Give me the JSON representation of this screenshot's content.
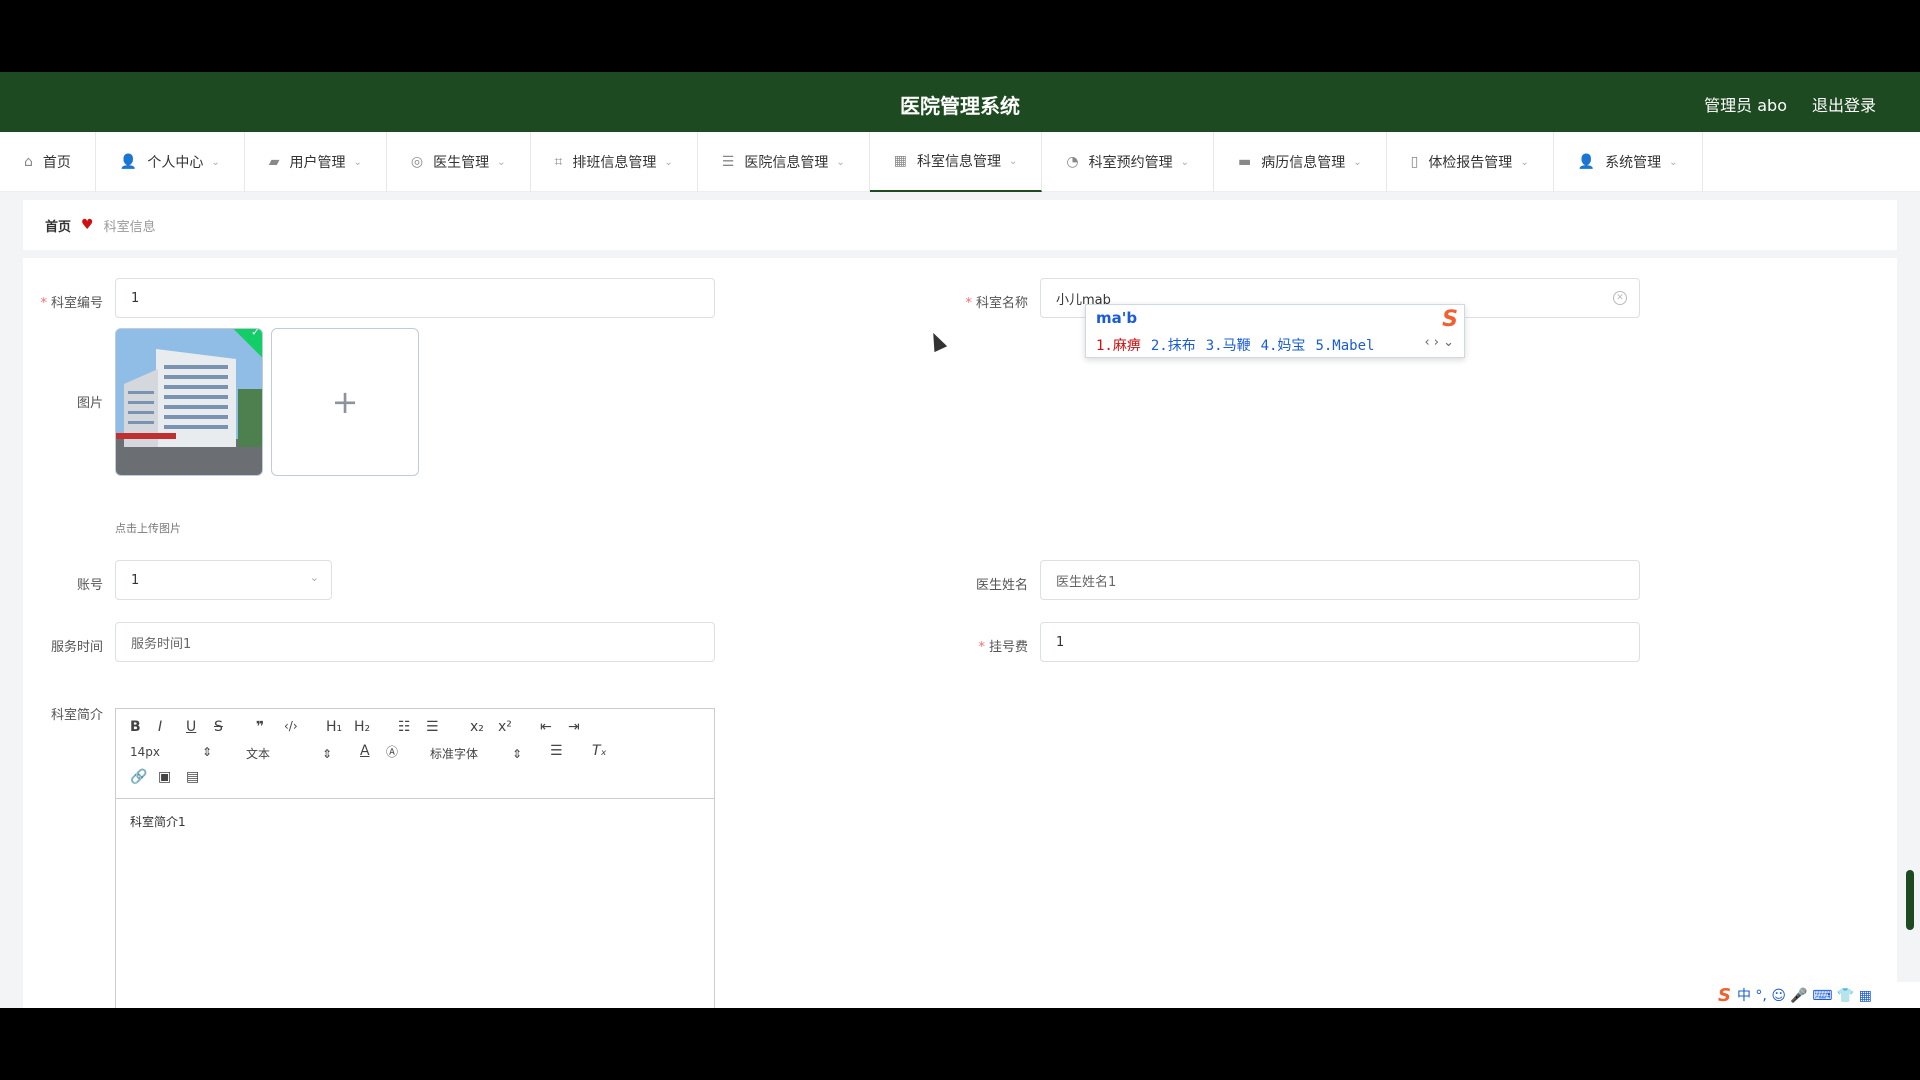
{
  "header": {
    "title": "医院管理系统",
    "admin": "管理员 abo",
    "logout": "退出登录"
  },
  "nav": [
    {
      "label": "首页",
      "icon": "home-icon",
      "glyph": "⌂",
      "dropdown": false
    },
    {
      "label": "个人中心",
      "icon": "user-icon",
      "glyph": "👤",
      "dropdown": true
    },
    {
      "label": "用户管理",
      "icon": "users-icon",
      "glyph": "▰",
      "dropdown": true
    },
    {
      "label": "医生管理",
      "icon": "target-icon",
      "glyph": "◎",
      "dropdown": true
    },
    {
      "label": "排班信息管理",
      "icon": "crop-icon",
      "glyph": "⌗",
      "dropdown": true
    },
    {
      "label": "医院信息管理",
      "icon": "sliders-icon",
      "glyph": "☰",
      "dropdown": true
    },
    {
      "label": "科室信息管理",
      "icon": "grid-icon",
      "glyph": "▦",
      "dropdown": true,
      "active": true
    },
    {
      "label": "科室预约管理",
      "icon": "gauge-icon",
      "glyph": "◔",
      "dropdown": true
    },
    {
      "label": "病历信息管理",
      "icon": "ticket-icon",
      "glyph": "▬",
      "dropdown": true
    },
    {
      "label": "体检报告管理",
      "icon": "mic-icon",
      "glyph": "▯",
      "dropdown": true
    },
    {
      "label": "系统管理",
      "icon": "person-icon",
      "glyph": "👤",
      "dropdown": true
    }
  ],
  "breadcrumb": {
    "home": "首页",
    "current": "科室信息"
  },
  "form": {
    "dept_no_label": "科室编号",
    "dept_no_value": "1",
    "dept_name_label": "科室名称",
    "dept_name_value": "小儿mab",
    "image_label": "图片",
    "upload_hint": "点击上传图片",
    "account_label": "账号",
    "account_value": "1",
    "doctor_name_label": "医生姓名",
    "doctor_name_value": "医生姓名1",
    "service_time_label": "服务时间",
    "service_time_value": "服务时间1",
    "fee_label": "挂号费",
    "fee_value": "1",
    "intro_label": "科室简介",
    "intro_value": "科室简介1"
  },
  "editor": {
    "size_select": "14px",
    "header_select": "文本",
    "font_select": "标准字体"
  },
  "ime": {
    "pinyin": "ma'b",
    "candidates": [
      "1.麻痹",
      "2.抹布",
      "3.马鞭",
      "4.妈宝",
      "5.Mabel"
    ],
    "tray": "中 °, ☺ 🎤 ⌨ 👕 ▦"
  }
}
